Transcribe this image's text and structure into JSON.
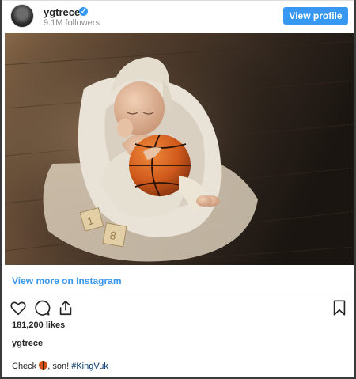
{
  "post": {
    "username": "ygtrece",
    "verified_icon": "verified-badge-icon",
    "followers": "9.1M followers",
    "view_profile_label": "View profile",
    "view_more_label": "View more on Instagram",
    "likes": "181,200 likes",
    "caption_username": "ygtrece",
    "caption_before": "Check ",
    "caption_emoji": "basketball-emoji",
    "caption_middle": ", son! ",
    "caption_hashtag": "#KingVuk"
  },
  "icons": {
    "like": "heart-icon",
    "comment": "comment-icon",
    "share": "share-icon",
    "save": "bookmark-icon"
  },
  "colors": {
    "accent": "#3897f0",
    "text": "#262626",
    "muted": "#8e8e8e",
    "hashtag": "#003569"
  }
}
